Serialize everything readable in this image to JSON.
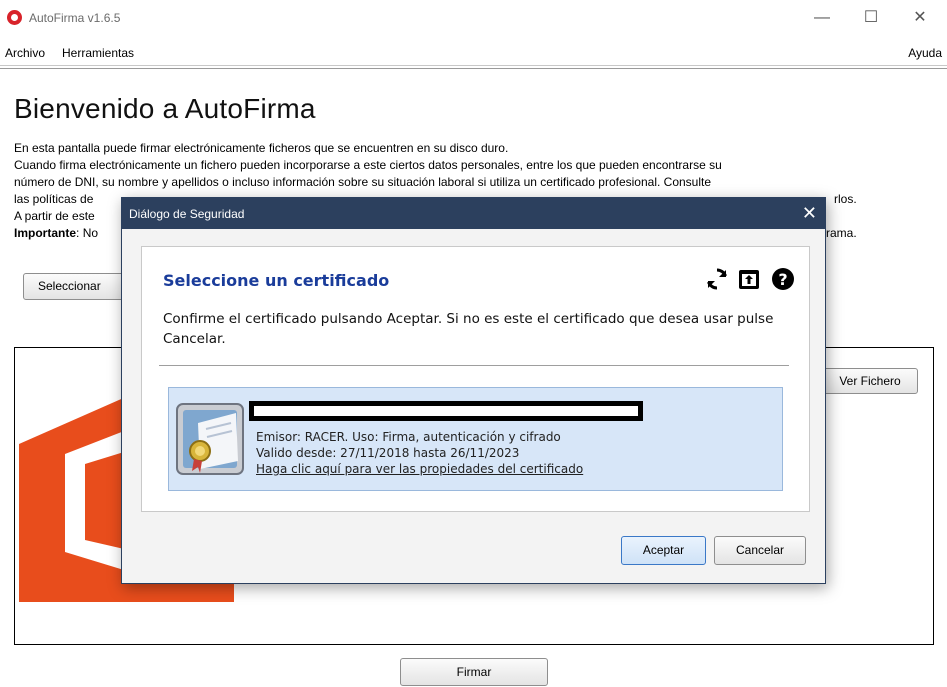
{
  "window": {
    "title": "AutoFirma v1.6.5",
    "minimize_symbol": "—",
    "maximize_symbol": "☐",
    "close_symbol": "✕"
  },
  "menu": {
    "archivo": "Archivo",
    "herramientas": "Herramientas",
    "ayuda": "Ayuda"
  },
  "main": {
    "title": "Bienvenido a AutoFirma",
    "intro": [
      "En esta pantalla puede firmar electrónicamente ficheros que se encuentren en su disco duro.",
      "Cuando firma electrónicamente un fichero pueden incorporarse a este ciertos datos personales, entre los que pueden encontrarse su",
      "número de DNI, su nombre y apellidos o incluso información sobre su situación laboral si utiliza un certificado profesional. Consulte",
      "las políticas de",
      "A partir de este",
      "No"
    ],
    "intro_tail_line4": "rlos.",
    "intro_tail_line6": "rama.",
    "important_label": "Importante",
    "select_button": "Seleccionar",
    "ver_fichero_button": "Ver Fichero",
    "firmar_button": "Firmar"
  },
  "dialog": {
    "title": "Diálogo de Seguridad",
    "close_symbol": "✕",
    "heading": "Seleccione un certificado",
    "message": "Confirme el certificado pulsando Aceptar. Si no es este el certificado que desea usar pulse Cancelar.",
    "certificate": {
      "issuer": "Emisor: RACER. Uso: Firma, autenticación y cifrado",
      "validity": "Valido desde: 27/11/2018 hasta 26/11/2023",
      "properties_link": "Haga clic aquí para ver las propiedades del certificado"
    },
    "accept_button": "Aceptar",
    "cancel_button": "Cancelar"
  },
  "colors": {
    "dialog_titlebar": "#2c405e",
    "heading_blue": "#1a3c9a",
    "cert_background": "#d7e6f8",
    "office_orange": "#e84d1c"
  }
}
